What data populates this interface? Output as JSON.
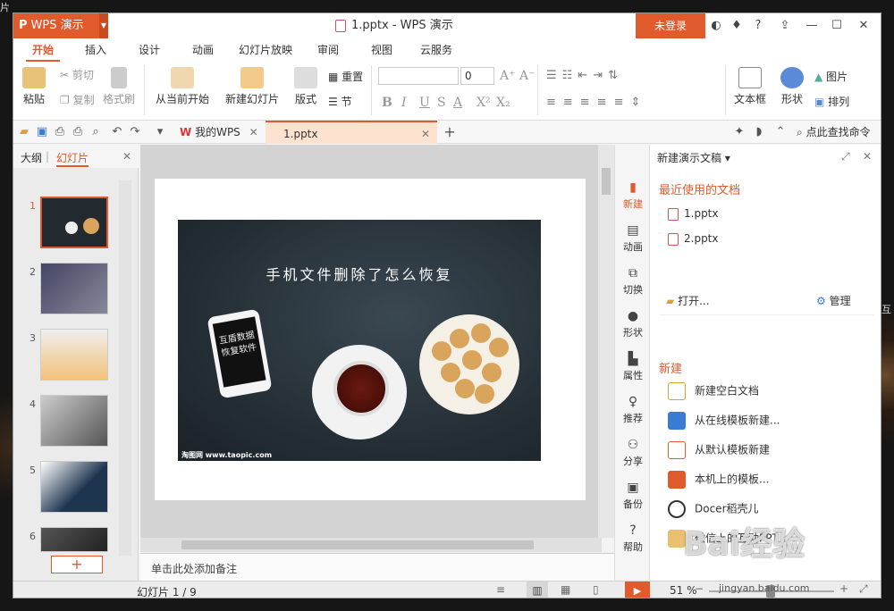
{
  "desktop": {
    "left_label": "片",
    "right_label": "互"
  },
  "app": {
    "name": "WPS 演示",
    "doc_title": "1.pptx - WPS 演示",
    "login": "未登录"
  },
  "menu": [
    "开始",
    "插入",
    "设计",
    "动画",
    "幻灯片放映",
    "审阅",
    "视图",
    "云服务"
  ],
  "ribbon": {
    "paste": "粘贴",
    "cut": "剪切",
    "copy": "复制",
    "format_painter": "格式刷",
    "from_current": "从当前开始",
    "new_slide": "新建幻灯片",
    "layout": "版式",
    "reset": "重置",
    "section": "节",
    "font_size": "0",
    "text_box": "文本框",
    "shape": "形状",
    "picture": "图片",
    "arrange": "排列"
  },
  "doc_tabs": {
    "my_wps": "我的WPS",
    "current": "1.pptx",
    "search_cmd": "点此查找命令"
  },
  "left_pane": {
    "outline_tab": "大纲",
    "slides_tab": "幻灯片",
    "numbers": [
      "1",
      "2",
      "3",
      "4",
      "5",
      "6"
    ]
  },
  "slide": {
    "title": "手机文件删除了怎么恢复",
    "phone_text": "互盾数据恢复软件",
    "credit": "淘图网  www.taopic.com"
  },
  "notes": "单击此处添加备注",
  "sidebar": [
    "新建",
    "动画",
    "切换",
    "形状",
    "属性",
    "推荐",
    "分享",
    "备份",
    "帮助"
  ],
  "task_pane": {
    "header": "新建演示文稿",
    "recent_title": "最近使用的文档",
    "recent": [
      "1.pptx",
      "2.pptx"
    ],
    "open": "打开...",
    "manage": "管理",
    "new_title": "新建",
    "new_items": [
      "新建空白文档",
      "从在线模板新建...",
      "从默认模板新建",
      "本机上的模板...",
      "Docer稻壳儿",
      "微信上的互动PPT"
    ]
  },
  "status": {
    "slide_counter": "幻灯片 1 / 9",
    "zoom": "51 %"
  },
  "watermark": {
    "text": "Bai经验",
    "url": "jingyan.baidu.com"
  },
  "colors": {
    "accent": "#e05a2b"
  }
}
